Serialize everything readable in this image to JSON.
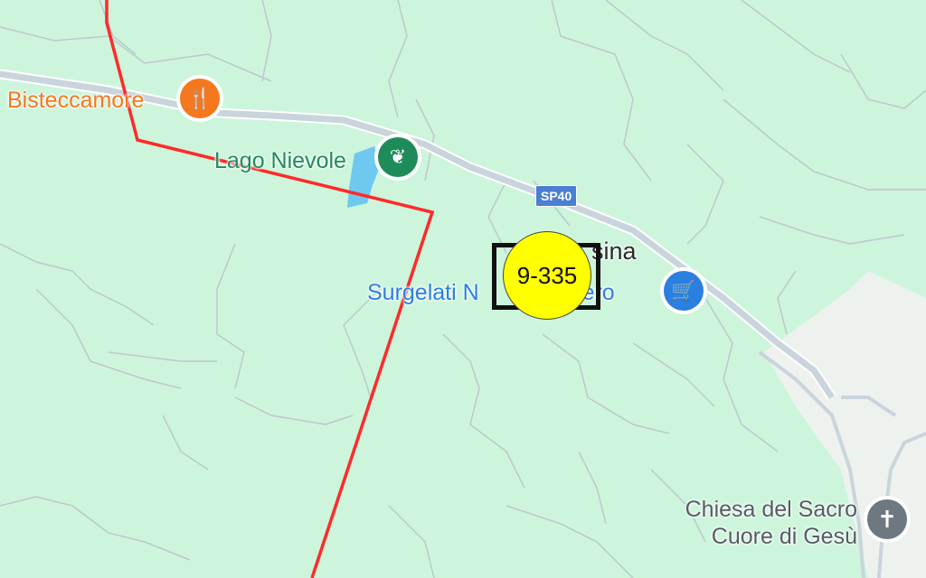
{
  "map": {
    "background_color": "#cdf5dc",
    "route_color": "#ff2a2a",
    "road_color": "#c9d4dc"
  },
  "places": {
    "restaurant": {
      "label": "Bistecca",
      "label_tail": "more",
      "icon": "fork-knife-icon",
      "color": "#f5781e"
    },
    "lake": {
      "label": "Lago Nievole",
      "icon": "nature-icon",
      "color": "#1e8c5a"
    },
    "locality": {
      "label": "sina"
    },
    "shop": {
      "label": "Surgelati N",
      "label_tail": "dero",
      "icon": "shopping-cart-icon",
      "color": "#2a7fe0"
    },
    "church": {
      "label_line1": "Chiesa del Sacro",
      "label_line2": "Cuore di Gesù",
      "icon": "cross-icon",
      "color": "#6e7880"
    }
  },
  "road_shield": {
    "label": "SP40",
    "color": "#4a7fd3"
  },
  "marker": {
    "label": "9-335",
    "color": "#ffff00"
  }
}
